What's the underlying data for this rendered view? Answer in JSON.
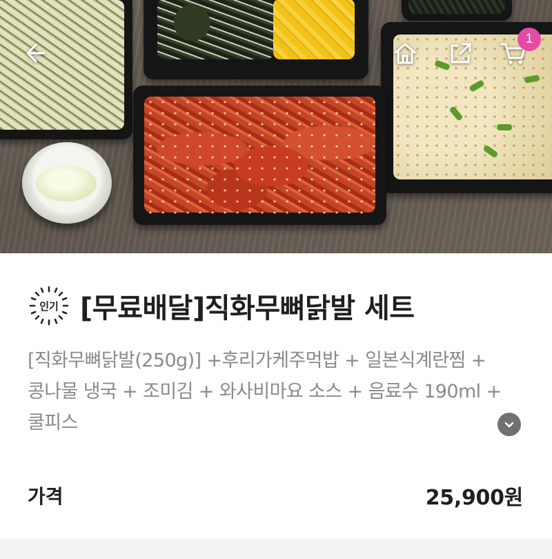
{
  "nav": {
    "back_icon": "arrow-left-icon",
    "home_icon": "home-icon",
    "share_icon": "share-icon",
    "cart_icon": "cart-icon",
    "cart_count": "1",
    "badge_color": "#e64aa5"
  },
  "product": {
    "badge_label": "인기",
    "title": "[무료배달]직화무뼈닭발 세트",
    "description": "[직화무뼈닭발(250g)] +후리가케주먹밥 + 일본식계란찜 + 콩나물 냉국 + 조미김  + 와사비마요 소스 + 음료수 190ml + 쿨피스",
    "expand_icon": "chevron-down-icon"
  },
  "price": {
    "label": "가격",
    "value": "25,900원"
  }
}
